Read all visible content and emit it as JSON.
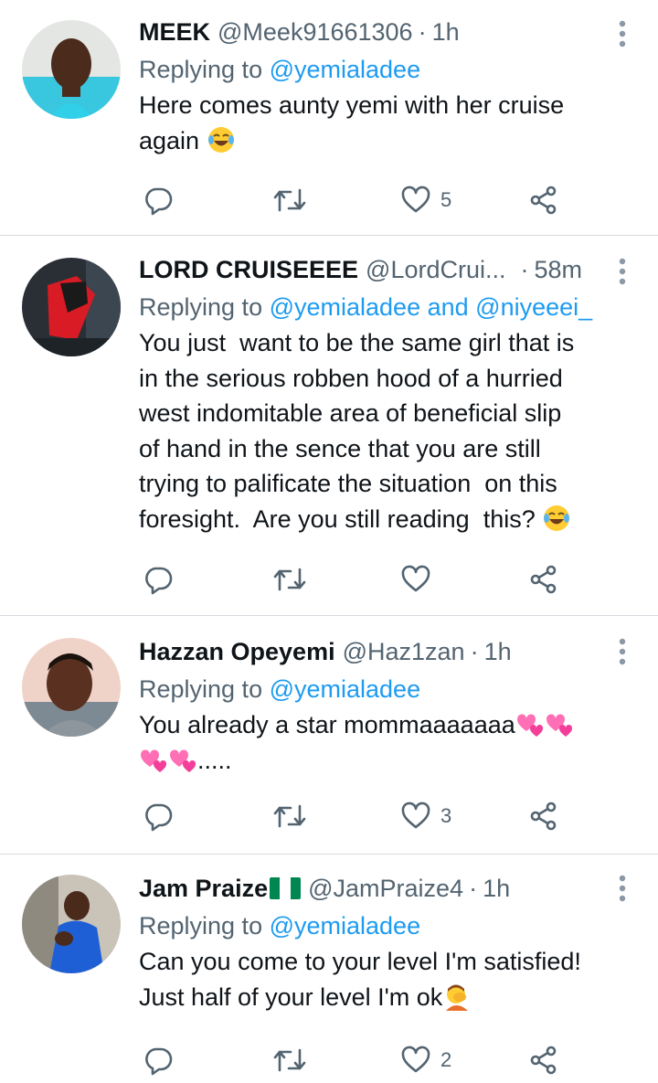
{
  "tweets": [
    {
      "name": "MEEK",
      "handle": "@Meek91661306",
      "dot": "·",
      "time": "1h",
      "replying_prefix": "Replying to ",
      "replying_to": [
        "@yemialadee"
      ],
      "text_lines": [
        "Here comes aunty yemi with her cruise",
        "again"
      ],
      "trailing_emoji": "tears-of-joy",
      "like_count": "5"
    },
    {
      "name": "LORD CRUISEEEE",
      "handle": "@LordCrui...",
      "dot": "·",
      "time": "58m",
      "replying_prefix": "Replying to ",
      "replying_to": [
        "@yemialadee",
        "@niyeeei_"
      ],
      "replying_joiner": " and ",
      "text_lines": [
        "You just  want to be the same girl that is",
        "in the serious robben hood of a hurried",
        "west indomitable area of beneficial slip",
        "of hand in the sence that you are still",
        "trying to palificate the situation  on this",
        "foresight.  Are you still reading  this?"
      ],
      "trailing_emoji": "tears-of-joy",
      "like_count": ""
    },
    {
      "name": "Hazzan Opeyemi",
      "handle": "@Haz1zan",
      "dot": "·",
      "time": "1h",
      "replying_prefix": "Replying to ",
      "replying_to": [
        "@yemialadee"
      ],
      "text_lines": [
        "You already a star mommaaaaaaa",
        "....."
      ],
      "trailing_emoji": "two-hearts",
      "like_count": "3"
    },
    {
      "name": "Jam Praize",
      "name_flag": "nigeria-flag",
      "handle": "@JamPraize4",
      "dot": "·",
      "time": "1h",
      "replying_prefix": "Replying to ",
      "replying_to": [
        "@yemialadee"
      ],
      "text_lines": [
        "Can you come to your level I'm satisfied!",
        "Just half of your level I'm ok"
      ],
      "trailing_emoji": "facepalm",
      "like_count": "2"
    }
  ],
  "icons": {
    "reply": "reply-icon",
    "retweet": "retweet-icon",
    "like": "heart-icon",
    "share": "share-icon",
    "more": "more-vertical-icon"
  },
  "colors": {
    "link": "#1d9bf0",
    "secondary_text": "#536471",
    "divider": "#d6dbe0",
    "flag_green": "#008751"
  }
}
